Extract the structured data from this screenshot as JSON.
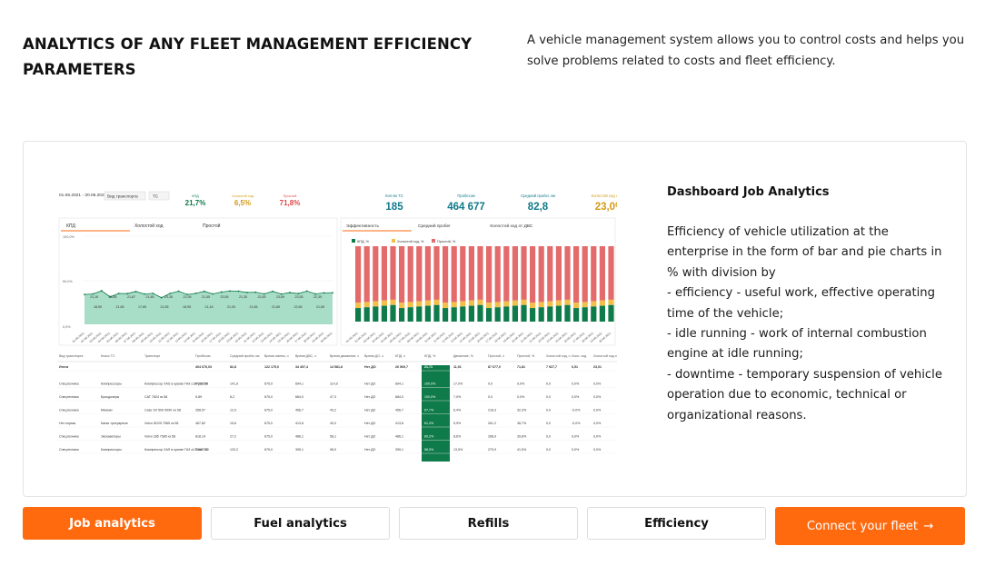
{
  "header": {
    "title": "ANALYTICS OF ANY FLEET MANAGEMENT EFFICIENCY PARAMETERS",
    "lede": "A vehicle management system allows you to control costs and helps you solve problems related to costs and fleet efficiency."
  },
  "panel": {
    "title": "Dashboard Job Analytics",
    "lines": [
      "Efficiency of vehicle utilization at the enterprise in the form of bar and pie charts in % with division by",
      "- efficiency - useful work, effective operating time of the vehicle;",
      "- idle running - work of internal combustion engine at idle running;",
      "- downtime - temporary suspension of vehicle operation due to economic, technical or organizational reasons."
    ]
  },
  "tabs": [
    {
      "label": "Job analytics",
      "active": true
    },
    {
      "label": "Fuel analytics",
      "active": false
    },
    {
      "label": "Refills",
      "active": false
    },
    {
      "label": "Efficiency",
      "active": false
    }
  ],
  "cta": {
    "label": "Connect your fleet",
    "arrow": "→"
  },
  "colors": {
    "accent": "#ff6a0f",
    "green": "#0f7a4a",
    "teal_area": "#9fd9c1",
    "red": "#e46b6b",
    "yellow": "#f1c04a"
  },
  "dashboard": {
    "filters": {
      "date": "01.06.2021 - 30.06.2021",
      "vehicle_type": "Вид транспорта",
      "ts": "ТС"
    },
    "left_kpis": [
      {
        "label": "КПД",
        "value": "21,7%",
        "color": "#0f7a4a"
      },
      {
        "label": "Холостой ход",
        "value": "6,5%",
        "color": "#d39a12"
      },
      {
        "label": "Простой",
        "value": "71,8%",
        "color": "#e04848"
      }
    ],
    "right_kpis": [
      {
        "label": "Кол-во ТС",
        "value": "185",
        "color": "#0f7a8a"
      },
      {
        "label": "Пробег,км",
        "value": "464 677",
        "color": "#0f7a8a"
      },
      {
        "label": "Средний пробег, км",
        "value": "82,8",
        "color": "#0f7a8a"
      },
      {
        "label": "Холостой ход от ДВС",
        "value": "23,0%",
        "color": "#d39a12"
      }
    ],
    "left_tabs": [
      "КПД",
      "Холостой ход",
      "Простой"
    ],
    "right_tabs": [
      "Эффективность",
      "Средний пробег",
      "Холостой ход от ДВС"
    ],
    "legend": [
      "КПД, %",
      "Холостой ход, %",
      "Простой, %"
    ],
    "y_ticks": [
      "100,0%",
      "50,0%",
      "0,0%"
    ],
    "table_headers": [
      "Вид транспорта",
      "Класс ТС",
      "Транспорт",
      "Пробег,км",
      "Средний пробег, км",
      "Время смены, ч",
      "Время ДВС, ч",
      "Время движения, ч",
      "Время ДО, ч",
      "КПД, ч",
      "КПД, %",
      "Движение, %",
      "Простой, ч",
      "Простой, %",
      "Холостой ход, ч",
      "Холо. ход",
      "Холостой ход от ДВС"
    ],
    "table_rows": [
      [
        "Итоги",
        "",
        "",
        "404 676,03",
        "82,8",
        "122 175,0",
        "34 497,4",
        "14 581,8",
        "Нет ДО",
        "26 569,7",
        "21,71",
        "11,91",
        "87 677,0",
        "71,81",
        "7 927,7",
        "6,51",
        "23,01"
      ],
      [
        "Спецтехника",
        "Компрессоры",
        "Компрессор XAS в кузове ГАЗ с187уа 750",
        "4 258,36",
        "141,9",
        "675,0",
        "694,1",
        "114,9",
        "Нет ДО",
        "694,1",
        "100,0%",
        "17,0%",
        "0,0",
        "0,0%",
        "0,0",
        "0,0%",
        "0,0%"
      ],
      [
        "Спецтехника",
        "Бульдозеры",
        "CAT 7824 хк 58",
        "6,89",
        "8,2",
        "675,0",
        "684,0",
        "47,3",
        "Нет ДО",
        "684,0",
        "100,0%",
        "7,0%",
        "0,0",
        "0,0%",
        "0,0",
        "0,0%",
        "0,0%"
      ],
      [
        "Спецтехника",
        "Минеки",
        "Case SV 500 5990 хн 58",
        "358,57",
        "12,0",
        "675,0",
        "456,7",
        "43,2",
        "Нет ДО",
        "456,7",
        "67,7%",
        "6,4%",
        "218,3",
        "32,3%",
        "0,0",
        "-0,0%",
        "0,0%"
      ],
      [
        "Нет нормы",
        "Катки тротуарные",
        "Volvo DD25 7565 хк 58",
        "467,82",
        "15,6",
        "675,0",
        "413,8",
        "40,0",
        "Нет ДО",
        "413,8",
        "61,3%",
        "5,9%",
        "261,2",
        "38,7%",
        "0,0",
        "-0,0%",
        "0,0%"
      ],
      [
        "Спецтехника",
        "Экскаваторы",
        "Volvo 285 7585 хк 58",
        "818,14",
        "27,2",
        "675,0",
        "486,1",
        "58,1",
        "Нет ДО",
        "486,1",
        "60,2%",
        "8,6%",
        "268,9",
        "39,8%",
        "0,0",
        "0,0%",
        "0,0%"
      ],
      [
        "Спецтехника",
        "Компрессоры",
        "Компрессор XAS в кузове ГАЗ а175ам 750",
        "3 607,41",
        "120,2",
        "675,0",
        "395,1",
        "98,9",
        "Нет ДО",
        "395,1",
        "58,5%",
        "13,5%",
        "279,9",
        "41,5%",
        "0,0",
        "0,0%",
        "0,0%"
      ]
    ],
    "line_labels": [
      "21,16",
      "23,85",
      "21,87",
      "21,85",
      "23,35",
      "21,95",
      "21,55",
      "23,55",
      "21,35",
      "23,45",
      "23,69",
      "23,55",
      "22,39"
    ],
    "line_labels_low": [
      "18,59",
      "21,65",
      "17,65",
      "21,55",
      "18,95",
      "21,16",
      "21,93",
      "21,65",
      "21,65",
      "22,65",
      "21,65"
    ],
    "left_dates": [
      "01.06.2021",
      "02.06.2021",
      "03.06.2021",
      "04.06.2021",
      "05.06.2021",
      "06.06.2021",
      "07.06.2021",
      "08.06.2021",
      "09.06.2021",
      "10.06.2021",
      "11.06.2021",
      "12.06.2021",
      "13.06.2021",
      "14.06.2021",
      "15.06.2021",
      "16.06.2021",
      "17.06.2021",
      "18.06.2021",
      "19.06.2021",
      "20.06.2021",
      "21.06.2021",
      "22.06.2021",
      "23.06.2021",
      "24.06.2021",
      "25.06.2021",
      "26.06.2021",
      "27.06.2021",
      "28.06.2021",
      "29.06.2021",
      "30.06.2021"
    ],
    "right_dates": [
      "01.06.2021",
      "02.06.2021",
      "03.06.2021",
      "04.06.2021",
      "05.06.2021",
      "06.06.2021",
      "07.06.2021",
      "08.06.2021",
      "09.06.2021",
      "10.06.2021",
      "11.06.2021",
      "12.06.2021",
      "13.06.2021",
      "14.06.2021",
      "15.06.2021",
      "16.06.2021",
      "17.06.2021",
      "18.06.2021",
      "19.06.2021",
      "20.06.2021",
      "21.06.2021",
      "22.06.2021",
      "23.06.2021",
      "24.06.2021",
      "25.06.2021",
      "26.06.2021",
      "27.06.2021",
      "28.06.2021",
      "29.06.2021",
      "30.06.2021"
    ]
  }
}
